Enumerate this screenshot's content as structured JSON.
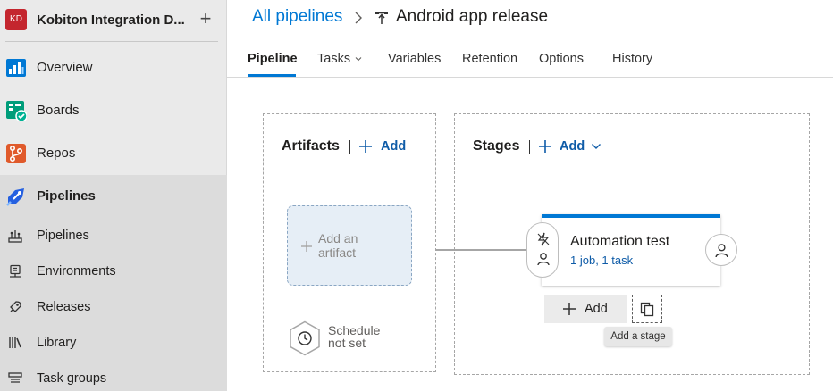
{
  "project": {
    "initials": "KD",
    "name": "Kobiton Integration D...",
    "add_symbol": "+"
  },
  "sidebar": {
    "items": [
      {
        "label": "Overview",
        "icon": "overview-icon"
      },
      {
        "label": "Boards",
        "icon": "boards-icon"
      },
      {
        "label": "Repos",
        "icon": "repos-icon"
      },
      {
        "label": "Pipelines",
        "icon": "pipelines-icon",
        "active": true
      }
    ],
    "sub_items": [
      {
        "label": "Pipelines",
        "icon": "pipelines-sub-icon"
      },
      {
        "label": "Environments",
        "icon": "environments-icon"
      },
      {
        "label": "Releases",
        "icon": "releases-icon"
      },
      {
        "label": "Library",
        "icon": "library-icon"
      },
      {
        "label": "Task groups",
        "icon": "task-groups-icon"
      }
    ]
  },
  "header": {
    "breadcrumb_link": "All pipelines",
    "title": "Android app release"
  },
  "tabs": [
    {
      "label": "Pipeline",
      "active": true
    },
    {
      "label": "Tasks",
      "has_dropdown": true
    },
    {
      "label": "Variables"
    },
    {
      "label": "Retention"
    },
    {
      "label": "Options"
    },
    {
      "label": "History"
    }
  ],
  "artifacts": {
    "title": "Artifacts",
    "add_label": "Add",
    "placeholder_line1": "Add an",
    "placeholder_line2": "artifact",
    "schedule_line1": "Schedule",
    "schedule_line2": "not set"
  },
  "stages": {
    "title": "Stages",
    "add_label": "Add",
    "stage": {
      "name": "Automation test",
      "summary": "1 job, 1 task"
    },
    "add_button_label": "Add",
    "tooltip": "Add a stage"
  },
  "colors": {
    "accent": "#0078d4",
    "link": "#0f5ca8",
    "sidebar_bg": "#eaeaea",
    "avatar": "#c4262e"
  }
}
